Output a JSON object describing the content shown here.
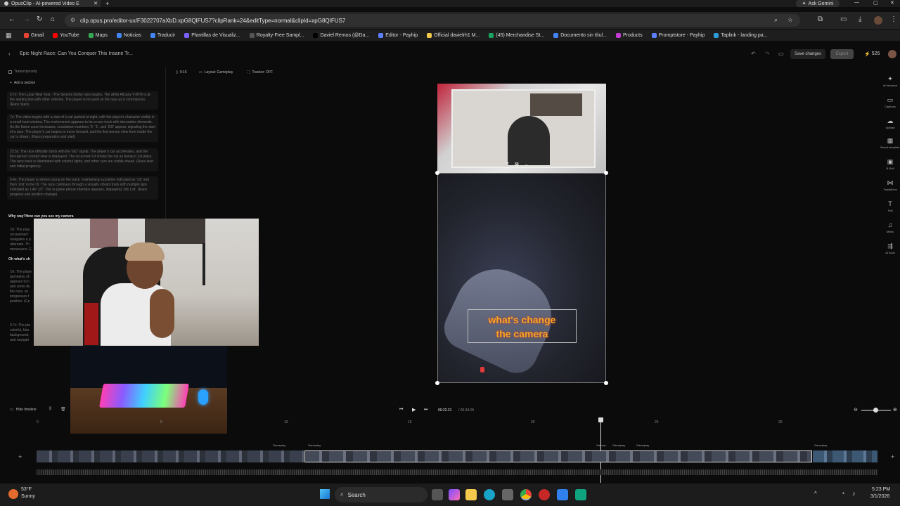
{
  "browser": {
    "tab_title": "OpusClip - AI-powered Video E",
    "url": "clip.opus.pro/editor-ux/F3022707aXbD.xpG8QIFUS7?clipRank=24&editType=normal&clipId=xpG8QIFUS7",
    "ask_gemini": "Ask Gemini",
    "bookmarks": [
      {
        "label": "Gmail",
        "color": "#ea4335"
      },
      {
        "label": "YouTube",
        "color": "#ff0000"
      },
      {
        "label": "Maps",
        "color": "#34a853"
      },
      {
        "label": "Noticias",
        "color": "#4285f4"
      },
      {
        "label": "Traducir",
        "color": "#4285f4"
      },
      {
        "label": "Plantillas de Visualiz...",
        "color": "#7b61ff"
      },
      {
        "label": "Royalty-Free Sampl...",
        "color": "#555555"
      },
      {
        "label": "Daviel Remos (@Da...",
        "color": "#000000"
      },
      {
        "label": "Editor - Payhip",
        "color": "#5b7fff"
      },
      {
        "label": "Official davielrh1 M...",
        "color": "#f2c94c"
      },
      {
        "label": "(45) Merchandise St...",
        "color": "#1aa260"
      },
      {
        "label": "Documento sin títul...",
        "color": "#4285f4"
      },
      {
        "label": "Products",
        "color": "#c43bd3"
      },
      {
        "label": "Promptstore - Payhip",
        "color": "#5b7fff"
      },
      {
        "label": "Taplink - landing pa...",
        "color": "#2d9cdb"
      }
    ]
  },
  "editor": {
    "project_title": "Epic Night Race: Can You Conquer This Insane Tr...",
    "save_changes": "Save changes",
    "export": "Export",
    "credits": "526",
    "aspect": "9:16",
    "layout": "Layout: Gameplay",
    "tracker": "Tracker: OFF",
    "transcript_only": "Transcript only",
    "add_section": "Add a section",
    "paragraphs": [
      {
        "text": "0.7s: The Lunar New Year - The Seneris Derby race begins. The white Aitcany V-BTR is at the starting line with other vehicles. The player is focused on the race as it commences. (Race Start)"
      },
      {
        "text": "7s: The video begins with a view of a car parked at night, with the player's character visible in a small inset window. The environment appears to be a race track with decorative elements. As the frame count increases, countdown numbers '3', '1', and 'GO' appear, signaling the start of a race. The player's car begins to move forward, and the first-person view from inside the car is shown. (Race preparation and start)"
      },
      {
        "text": "23.5s: The race officially starts with the 'GO' signal. The player's car accelerates, and the first-person cockpit view is displayed. The on-screen UI shows the car as being in 1st place. The race track is illuminated with colorful lights, and other cars are visible ahead. (Race start and initial progress)"
      },
      {
        "text": "0.4s: The player is shown racing on the track, maintaining a position indicated as '1st' and then '2nd' in the UI. The race continues through a visually vibrant track with multiple laps indicated as 'LAP 1/2'. The in-game phone interface appears, displaying 'Job List'. (Race progress and position change)"
      }
    ],
    "section_why": "Why way?How can you see my camera",
    "section_oh": "Oh what's ch",
    "p_frag1": "Os: The play occasional t navigates a p alternate. Th maneuvers. E",
    "p_frag2": "Os: The playe gameplay sh appears to b and some 8u the race, su progresses t position. (Ge",
    "p_frag3": "3.7s: The pla colorful, futu background, and navigati",
    "caption_line1": "what's change",
    "caption_line2": "the camera",
    "sidebar": [
      {
        "label": "AI enhance",
        "icon": "✦"
      },
      {
        "label": "Captions",
        "icon": "▭"
      },
      {
        "label": "Upload",
        "icon": "☁"
      },
      {
        "label": "Brand template",
        "icon": "▦"
      },
      {
        "label": "B-Roll",
        "icon": "▣"
      },
      {
        "label": "Transitions",
        "icon": "⋈"
      },
      {
        "label": "Text",
        "icon": "T"
      },
      {
        "label": "Music",
        "icon": "♫"
      },
      {
        "label": "AI hook",
        "icon": "⇶"
      }
    ],
    "timeline": {
      "hide_timeline": "Hide timeline",
      "current_time": "00:22.21",
      "total_time": "/ 00:34.05",
      "ruler": [
        "0",
        "5",
        "10",
        "15",
        "20",
        "25",
        "30"
      ],
      "clip_labels": [
        "Gameplay",
        "Gameplay",
        "Gamep...",
        "Gameplay",
        "Gameplay",
        "Gameplay"
      ]
    }
  },
  "taskbar": {
    "temp": "53°F",
    "weather": "Sunny",
    "search": "Search",
    "time": "5:23 PM",
    "date": "3/1/2026"
  }
}
